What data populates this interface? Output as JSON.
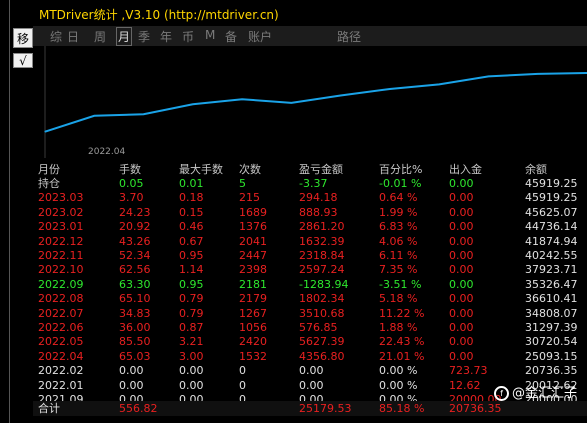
{
  "window": {
    "title": "MTDriver统计 ,V3.10 (http://mtdriver.cn)"
  },
  "left_toolbar": {
    "icon1": "移",
    "icon2": "√"
  },
  "tabs": [
    {
      "label": "综",
      "active": false
    },
    {
      "label": "日",
      "active": false
    },
    {
      "label": "周",
      "active": false
    },
    {
      "label": "月",
      "active": true
    },
    {
      "label": "季",
      "active": false
    },
    {
      "label": "年",
      "active": false
    },
    {
      "label": "币",
      "active": false
    },
    {
      "label": "M",
      "active": false
    },
    {
      "label": "备",
      "active": false
    },
    {
      "label": "账户",
      "active": false
    },
    {
      "label": "路径",
      "active": false
    }
  ],
  "chart_data": {
    "type": "line",
    "x_tick": "2022.04",
    "color": "#1aa3e8",
    "values": [
      25093.15,
      30720.54,
      31297.39,
      34808.07,
      36610.41,
      35326.47,
      37923.71,
      40242.55,
      41874.94,
      44736.14,
      45625.07,
      45919.25
    ]
  },
  "table": {
    "headers": [
      "月份",
      "手数",
      "最大手数",
      "次数",
      "盈亏金额",
      "百分比%",
      "出入金",
      "余额"
    ],
    "rows": [
      {
        "cells": [
          "持仓",
          "0.05",
          "0.01",
          "5",
          "-3.37",
          "-0.01 %",
          "0.00",
          "45919.25"
        ],
        "color": "#2ee82e"
      },
      {
        "cells": [
          "2023.03",
          "3.70",
          "0.18",
          "215",
          "294.18",
          "0.64 %",
          "0.00",
          "45919.25"
        ],
        "color": "#e82020"
      },
      {
        "cells": [
          "2023.02",
          "24.23",
          "0.15",
          "1689",
          "888.93",
          "1.99 %",
          "0.00",
          "45625.07"
        ],
        "color": "#e82020"
      },
      {
        "cells": [
          "2023.01",
          "20.92",
          "0.46",
          "1376",
          "2861.20",
          "6.83 %",
          "0.00",
          "44736.14"
        ],
        "color": "#e82020"
      },
      {
        "cells": [
          "2022.12",
          "43.26",
          "0.67",
          "2041",
          "1632.39",
          "4.06 %",
          "0.00",
          "41874.94"
        ],
        "color": "#e82020"
      },
      {
        "cells": [
          "2022.11",
          "52.34",
          "0.95",
          "2447",
          "2318.84",
          "6.11 %",
          "0.00",
          "40242.55"
        ],
        "color": "#e82020"
      },
      {
        "cells": [
          "2022.10",
          "62.56",
          "1.14",
          "2398",
          "2597.24",
          "7.35 %",
          "0.00",
          "37923.71"
        ],
        "color": "#e82020"
      },
      {
        "cells": [
          "2022.09",
          "63.30",
          "0.95",
          "2181",
          "-1283.94",
          "-3.51 %",
          "0.00",
          "35326.47"
        ],
        "color": "#2ee82e"
      },
      {
        "cells": [
          "2022.08",
          "65.10",
          "0.79",
          "2179",
          "1802.34",
          "5.18 %",
          "0.00",
          "36610.41"
        ],
        "color": "#e82020"
      },
      {
        "cells": [
          "2022.07",
          "34.83",
          "0.79",
          "1267",
          "3510.68",
          "11.22 %",
          "0.00",
          "34808.07"
        ],
        "color": "#e82020"
      },
      {
        "cells": [
          "2022.06",
          "36.00",
          "0.87",
          "1056",
          "576.85",
          "1.88 %",
          "0.00",
          "31297.39"
        ],
        "color": "#e82020"
      },
      {
        "cells": [
          "2022.05",
          "85.50",
          "3.21",
          "2420",
          "5627.39",
          "22.43 %",
          "0.00",
          "30720.54"
        ],
        "color": "#e82020"
      },
      {
        "cells": [
          "2022.04",
          "65.03",
          "3.00",
          "1532",
          "4356.80",
          "21.01 %",
          "0.00",
          "25093.15"
        ],
        "color": "#e82020"
      },
      {
        "cells": [
          "2022.02",
          "0.00",
          "0.00",
          "0",
          "0.00",
          "0.00 %",
          "723.73",
          "20736.35"
        ],
        "color": "#e0e0e0",
        "flow_color": "#e82020"
      },
      {
        "cells": [
          "2022.01",
          "0.00",
          "0.00",
          "0",
          "0.00",
          "0.00 %",
          "12.62",
          "20012.62"
        ],
        "color": "#e0e0e0",
        "flow_color": "#e82020"
      },
      {
        "cells": [
          "2021.09",
          "0.00",
          "0.00",
          "0",
          "0.00",
          "0.00 %",
          "20000.00",
          "20000.00"
        ],
        "color": "#e0e0e0",
        "flow_color": "#e82020"
      }
    ],
    "total": {
      "cells": [
        "合计",
        "556.82",
        "",
        "",
        "25179.53",
        "85.18 %",
        "20736.35",
        ""
      ],
      "color": "#e82020",
      "label_color": "#e0e0e0"
    }
  },
  "watermark": "@金汇汇子"
}
